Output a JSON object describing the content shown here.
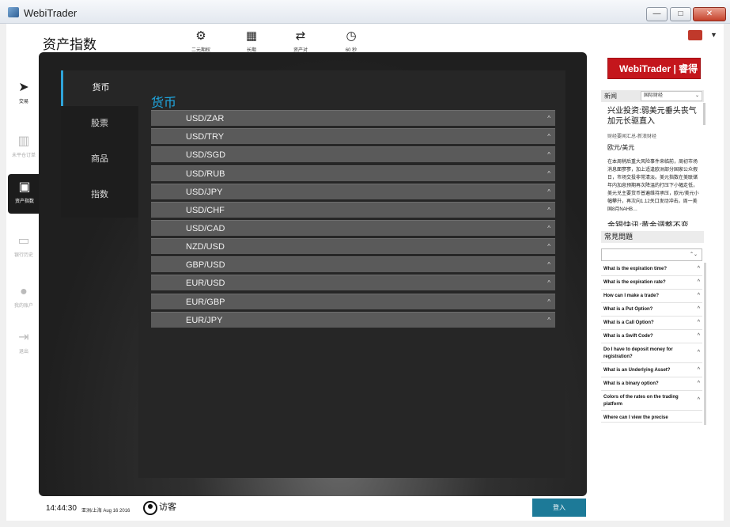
{
  "window": {
    "title": "WebiTrader",
    "min_label": "—",
    "max_label": "□",
    "close_label": "✕"
  },
  "header": {
    "page_title": "资产指数",
    "mode_tabs": [
      {
        "label": "二元期权",
        "icon": "gear-icon"
      },
      {
        "label": "长期",
        "icon": "calendar-icon"
      },
      {
        "label": "资产对",
        "icon": "swap-arrows-icon"
      },
      {
        "label": "60 秒",
        "icon": "stopwatch-icon"
      }
    ]
  },
  "nav": {
    "items": [
      {
        "label": "交易",
        "icon": "cursor-icon"
      },
      {
        "label": "未平仓订单",
        "icon": "bar-chart-icon"
      },
      {
        "label": "资产指数",
        "icon": "book-icon"
      },
      {
        "label": "银行历史",
        "icon": "card-icon"
      },
      {
        "label": "我的账户",
        "icon": "user-icon"
      },
      {
        "label": "退出",
        "icon": "logout-icon"
      }
    ]
  },
  "tabs": [
    "货币",
    "股票",
    "商品",
    "指数"
  ],
  "content": {
    "section_title": "货币",
    "assets": [
      "USD/ZAR",
      "USD/TRY",
      "USD/SGD",
      "USD/RUB",
      "USD/JPY",
      "USD/CHF",
      "USD/CAD",
      "NZD/USD",
      "GBP/USD",
      "EUR/USD",
      "EUR/GBP",
      "EUR/JPY"
    ]
  },
  "sidebar": {
    "logo_text": "WebiTrader | 睿得",
    "news": {
      "label": "新闻",
      "source_select": "国际财经",
      "headline": "兴业投资:弱美元垂头丧气 加元长驱直入",
      "meta": "财经要闻汇总-新浪财经",
      "pair": "欧元/美元",
      "body": "在本周稍后重大风险事件来临前，周初市场消息面寥寥，加上适逢欧洲部分国家公众假日，市场交投非常清淡。美元指数在美联储年内加息预期再次降温的打压下小幅走低，美元兑主要货币普遍维持承压，欧元/美元小幅攀升，再次向1.12关口发动冲击。周一美国8月NAHB…",
      "second_headline": "金银快讯:黄金调整不变"
    },
    "faq": {
      "title": "常見問題",
      "items": [
        "What is the expiration time?",
        "What is the expiration rate?",
        "How can I make a trade?",
        "What is a Put Option?",
        "What is a Call Option?",
        "What is a Swift Code?",
        "Do I have to deposit money for registration?",
        "What is an Underlying Asset?",
        "What is a binary option?",
        "Colors of the rates on the trading platform",
        "Where can I view the precise"
      ]
    }
  },
  "footer": {
    "time": "14:44:30",
    "timezone_date": "亚洲/上海 Aug 16 2016",
    "user": "访客",
    "login_label": "登入"
  }
}
